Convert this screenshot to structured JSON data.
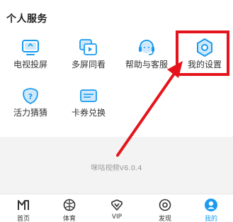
{
  "section": {
    "title": "个人服务"
  },
  "services": [
    {
      "label": "电视投屏",
      "icon": "tv-cast-icon"
    },
    {
      "label": "多屏同看",
      "icon": "multi-screen-icon"
    },
    {
      "label": "帮助与客服",
      "icon": "customer-service-icon"
    },
    {
      "label": "我的设置",
      "icon": "settings-icon"
    },
    {
      "label": "活力猜猜",
      "icon": "guess-icon"
    },
    {
      "label": "卡券兑换",
      "icon": "coupon-icon"
    }
  ],
  "version": "咪咕视频V6.0.4",
  "tabs": [
    {
      "label": "首页",
      "icon": "home-logo-icon"
    },
    {
      "label": "体育",
      "icon": "ball-icon"
    },
    {
      "label": "VIP",
      "icon": "vip-icon"
    },
    {
      "label": "发现",
      "icon": "discover-icon"
    },
    {
      "label": "我的",
      "icon": "user-icon",
      "active": true
    }
  ],
  "colors": {
    "accent": "#1a9bf0",
    "annotation": "#e5141c"
  }
}
